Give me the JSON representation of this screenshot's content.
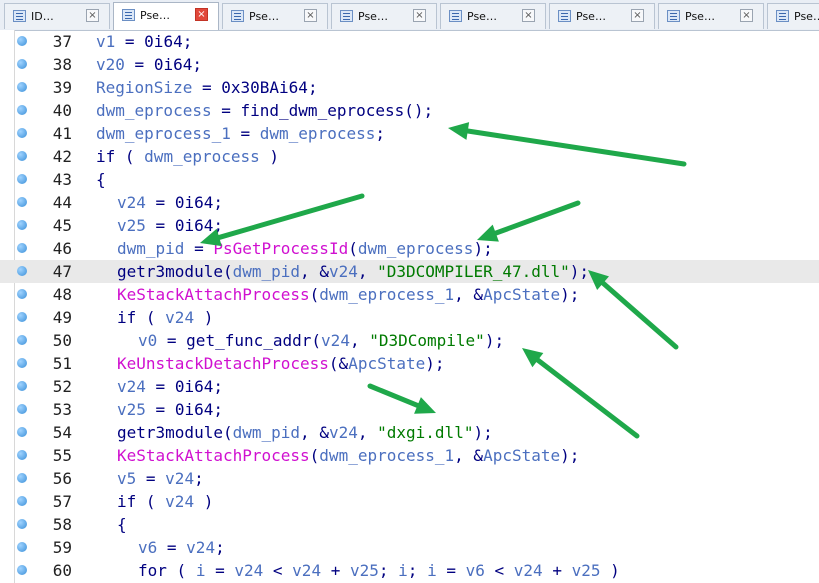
{
  "tabs": [
    {
      "label": "ID…",
      "active": false
    },
    {
      "label": "Pse…",
      "active": true
    },
    {
      "label": "Pse…",
      "active": false
    },
    {
      "label": "Pse…",
      "active": false
    },
    {
      "label": "Pse…",
      "active": false
    },
    {
      "label": "Pse…",
      "active": false
    },
    {
      "label": "Pse…",
      "active": false
    },
    {
      "label": "Pse…",
      "active": false
    }
  ],
  "close_glyph": "×",
  "highlighted_line": 47,
  "code_lines": [
    {
      "num": "37",
      "indent": 0,
      "tokens": [
        [
          "var",
          "v1"
        ],
        [
          "op",
          " = "
        ],
        [
          "num",
          "0i64"
        ],
        [
          "op",
          ";"
        ]
      ]
    },
    {
      "num": "38",
      "indent": 0,
      "tokens": [
        [
          "var",
          "v20"
        ],
        [
          "op",
          " = "
        ],
        [
          "num",
          "0i64"
        ],
        [
          "op",
          ";"
        ]
      ]
    },
    {
      "num": "39",
      "indent": 0,
      "tokens": [
        [
          "var",
          "RegionSize"
        ],
        [
          "op",
          " = "
        ],
        [
          "num",
          "0x30BAi64"
        ],
        [
          "op",
          ";"
        ]
      ]
    },
    {
      "num": "40",
      "indent": 0,
      "tokens": [
        [
          "var",
          "dwm_eprocess"
        ],
        [
          "op",
          " = "
        ],
        [
          "fn",
          "find_dwm_eprocess"
        ],
        [
          "op",
          "();"
        ]
      ]
    },
    {
      "num": "41",
      "indent": 0,
      "tokens": [
        [
          "var",
          "dwm_eprocess_1"
        ],
        [
          "op",
          " = "
        ],
        [
          "var",
          "dwm_eprocess"
        ],
        [
          "op",
          ";"
        ]
      ]
    },
    {
      "num": "42",
      "indent": 0,
      "tokens": [
        [
          "kw",
          "if"
        ],
        [
          "op",
          " ( "
        ],
        [
          "var",
          "dwm_eprocess"
        ],
        [
          "op",
          " )"
        ]
      ]
    },
    {
      "num": "43",
      "indent": 0,
      "tokens": [
        [
          "op",
          "{"
        ]
      ]
    },
    {
      "num": "44",
      "indent": 1,
      "tokens": [
        [
          "var",
          "v24"
        ],
        [
          "op",
          " = "
        ],
        [
          "num",
          "0i64"
        ],
        [
          "op",
          ";"
        ]
      ]
    },
    {
      "num": "45",
      "indent": 1,
      "tokens": [
        [
          "var",
          "v25"
        ],
        [
          "op",
          " = "
        ],
        [
          "num",
          "0i64"
        ],
        [
          "op",
          ";"
        ]
      ]
    },
    {
      "num": "46",
      "indent": 1,
      "tokens": [
        [
          "var",
          "dwm_pid"
        ],
        [
          "op",
          " = "
        ],
        [
          "api",
          "PsGetProcessId"
        ],
        [
          "op",
          "("
        ],
        [
          "var",
          "dwm_eprocess"
        ],
        [
          "op",
          ");"
        ]
      ]
    },
    {
      "num": "47",
      "indent": 1,
      "tokens": [
        [
          "fn",
          "getr3module"
        ],
        [
          "op",
          "("
        ],
        [
          "var",
          "dwm_pid"
        ],
        [
          "op",
          ", &"
        ],
        [
          "var",
          "v24"
        ],
        [
          "op",
          ", "
        ],
        [
          "str",
          "\"D3DCOMPILER_47.dll\""
        ],
        [
          "op",
          ");"
        ]
      ]
    },
    {
      "num": "48",
      "indent": 1,
      "tokens": [
        [
          "api",
          "KeStackAttachProcess"
        ],
        [
          "op",
          "("
        ],
        [
          "var",
          "dwm_eprocess_1"
        ],
        [
          "op",
          ", &"
        ],
        [
          "var",
          "ApcState"
        ],
        [
          "op",
          ");"
        ]
      ]
    },
    {
      "num": "49",
      "indent": 1,
      "tokens": [
        [
          "kw",
          "if"
        ],
        [
          "op",
          " ( "
        ],
        [
          "var",
          "v24"
        ],
        [
          "op",
          " )"
        ]
      ]
    },
    {
      "num": "50",
      "indent": 2,
      "tokens": [
        [
          "var",
          "v0"
        ],
        [
          "op",
          " = "
        ],
        [
          "fn",
          "get_func_addr"
        ],
        [
          "op",
          "("
        ],
        [
          "var",
          "v24"
        ],
        [
          "op",
          ", "
        ],
        [
          "str",
          "\"D3DCompile\""
        ],
        [
          "op",
          ");"
        ]
      ]
    },
    {
      "num": "51",
      "indent": 1,
      "tokens": [
        [
          "api",
          "KeUnstackDetachProcess"
        ],
        [
          "op",
          "(&"
        ],
        [
          "var",
          "ApcState"
        ],
        [
          "op",
          ");"
        ]
      ]
    },
    {
      "num": "52",
      "indent": 1,
      "tokens": [
        [
          "var",
          "v24"
        ],
        [
          "op",
          " = "
        ],
        [
          "num",
          "0i64"
        ],
        [
          "op",
          ";"
        ]
      ]
    },
    {
      "num": "53",
      "indent": 1,
      "tokens": [
        [
          "var",
          "v25"
        ],
        [
          "op",
          " = "
        ],
        [
          "num",
          "0i64"
        ],
        [
          "op",
          ";"
        ]
      ]
    },
    {
      "num": "54",
      "indent": 1,
      "tokens": [
        [
          "fn",
          "getr3module"
        ],
        [
          "op",
          "("
        ],
        [
          "var",
          "dwm_pid"
        ],
        [
          "op",
          ", &"
        ],
        [
          "var",
          "v24"
        ],
        [
          "op",
          ", "
        ],
        [
          "str",
          "\"dxgi.dll\""
        ],
        [
          "op",
          ");"
        ]
      ]
    },
    {
      "num": "55",
      "indent": 1,
      "tokens": [
        [
          "api",
          "KeStackAttachProcess"
        ],
        [
          "op",
          "("
        ],
        [
          "var",
          "dwm_eprocess_1"
        ],
        [
          "op",
          ", &"
        ],
        [
          "var",
          "ApcState"
        ],
        [
          "op",
          ");"
        ]
      ]
    },
    {
      "num": "56",
      "indent": 1,
      "tokens": [
        [
          "var",
          "v5"
        ],
        [
          "op",
          " = "
        ],
        [
          "var",
          "v24"
        ],
        [
          "op",
          ";"
        ]
      ]
    },
    {
      "num": "57",
      "indent": 1,
      "tokens": [
        [
          "kw",
          "if"
        ],
        [
          "op",
          " ( "
        ],
        [
          "var",
          "v24"
        ],
        [
          "op",
          " )"
        ]
      ]
    },
    {
      "num": "58",
      "indent": 1,
      "tokens": [
        [
          "op",
          "{"
        ]
      ]
    },
    {
      "num": "59",
      "indent": 2,
      "tokens": [
        [
          "var",
          "v6"
        ],
        [
          "op",
          " = "
        ],
        [
          "var",
          "v24"
        ],
        [
          "op",
          ";"
        ]
      ]
    },
    {
      "num": "60",
      "indent": 2,
      "tokens": [
        [
          "kw",
          "for"
        ],
        [
          "op",
          " ( "
        ],
        [
          "var",
          "i"
        ],
        [
          "op",
          " = "
        ],
        [
          "var",
          "v24"
        ],
        [
          "op",
          " < "
        ],
        [
          "var",
          "v24"
        ],
        [
          "op",
          " + "
        ],
        [
          "var",
          "v25"
        ],
        [
          "op",
          "; "
        ],
        [
          "var",
          "i"
        ],
        [
          "op",
          "; "
        ],
        [
          "var",
          "i"
        ],
        [
          "op",
          " = "
        ],
        [
          "var",
          "v6"
        ],
        [
          "op",
          " < "
        ],
        [
          "var",
          "v24"
        ],
        [
          "op",
          " + "
        ],
        [
          "var",
          "v25"
        ],
        [
          "op",
          " )"
        ]
      ]
    }
  ],
  "colors": {
    "variable": "#4b6fbf",
    "keyword_function": "#000080",
    "api": "#d010d0",
    "string": "#007a00",
    "arrow": "#1fa84a",
    "highlight_row": "#e9e9e9"
  },
  "icons": {
    "tab_icon": "pseudocode-view-icon",
    "tab_close": "close-icon",
    "gutter_marker": "breakpoint-dot-icon",
    "annotation": "green-arrow"
  }
}
